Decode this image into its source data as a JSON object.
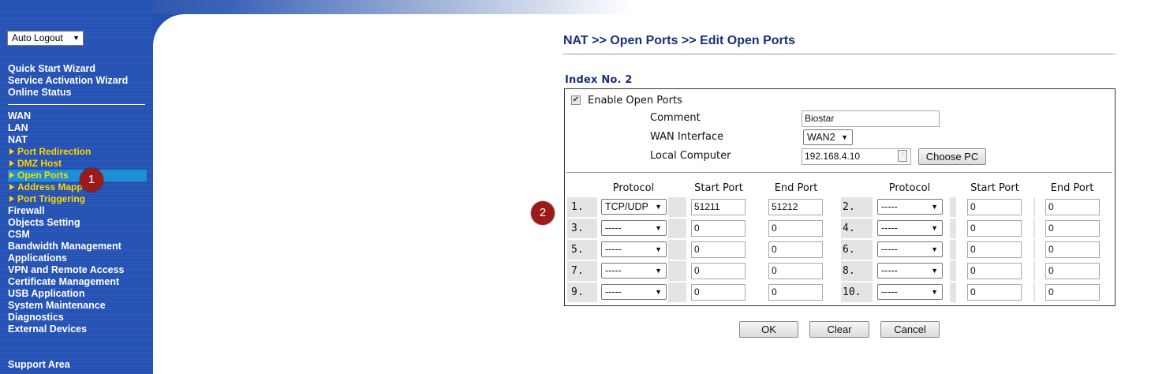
{
  "sidebar": {
    "auto_logout": "Auto Logout",
    "items": {
      "quick_start": "Quick Start Wizard",
      "service_activation": "Service Activation Wizard",
      "online_status": "Online Status",
      "wan": "WAN",
      "lan": "LAN",
      "nat": "NAT",
      "port_redirection": "Port Redirection",
      "dmz_host": "DMZ Host",
      "open_ports": "Open Ports",
      "address_mapping": "Address Mapp",
      "port_triggering": "Port Triggering",
      "firewall": "Firewall",
      "objects_setting": "Objects Setting",
      "csm": "CSM",
      "bandwidth": "Bandwidth Management",
      "applications": "Applications",
      "vpn": "VPN and Remote Access",
      "certificate": "Certificate Management",
      "usb": "USB Application",
      "system_maintenance": "System Maintenance",
      "diagnostics": "Diagnostics",
      "external_devices": "External Devices",
      "support_area": "Support Area"
    }
  },
  "badges": {
    "one": "1",
    "two": "2"
  },
  "page": {
    "title": "NAT >> Open Ports >> Edit Open Ports",
    "index_label": "Index No. 2"
  },
  "form": {
    "enable_label": "Enable Open Ports",
    "enable_checked": true,
    "comment_label": "Comment",
    "comment_value": "Biostar",
    "wan_label": "WAN Interface",
    "wan_value": "WAN2",
    "local_label": "Local Computer",
    "local_value": "192.168.4.10",
    "choose_pc": "Choose PC"
  },
  "table": {
    "headers": {
      "protocol": "Protocol",
      "start": "Start Port",
      "end": "End Port"
    },
    "rows": [
      {
        "left": {
          "num": "1.",
          "protocol": "TCP/UDP",
          "start": "51211",
          "end": "51212"
        },
        "right": {
          "num": "2.",
          "protocol": "-----",
          "start": "0",
          "end": "0"
        }
      },
      {
        "left": {
          "num": "3.",
          "protocol": "-----",
          "start": "0",
          "end": "0"
        },
        "right": {
          "num": "4.",
          "protocol": "-----",
          "start": "0",
          "end": "0"
        }
      },
      {
        "left": {
          "num": "5.",
          "protocol": "-----",
          "start": "0",
          "end": "0"
        },
        "right": {
          "num": "6.",
          "protocol": "-----",
          "start": "0",
          "end": "0"
        }
      },
      {
        "left": {
          "num": "7.",
          "protocol": "-----",
          "start": "0",
          "end": "0"
        },
        "right": {
          "num": "8.",
          "protocol": "-----",
          "start": "0",
          "end": "0"
        }
      },
      {
        "left": {
          "num": "9.",
          "protocol": "-----",
          "start": "0",
          "end": "0"
        },
        "right": {
          "num": "10.",
          "protocol": "-----",
          "start": "0",
          "end": "0"
        }
      }
    ]
  },
  "buttons": {
    "ok": "OK",
    "clear": "Clear",
    "cancel": "Cancel"
  },
  "colors": {
    "sidebar": "#2250b3",
    "sub_menu": "#ffd500",
    "title": "#1a2f7a",
    "badge": "#9b1b1b",
    "active": "#1e8fd6"
  }
}
